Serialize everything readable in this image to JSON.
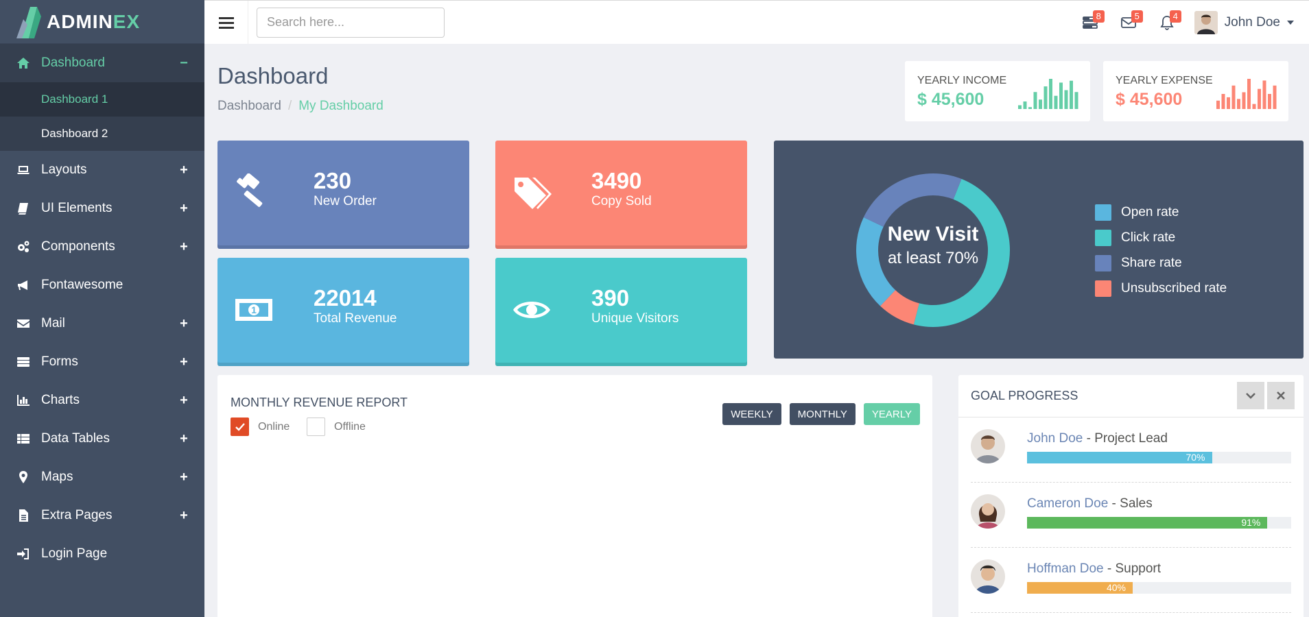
{
  "brand": {
    "name_main": "ADMIN",
    "name_accent": "EX"
  },
  "sidebar": {
    "items": [
      {
        "label": "Dashboard",
        "icon": "home-icon",
        "toggle": "−"
      },
      {
        "label": "Layouts",
        "icon": "laptop-icon",
        "toggle": "+"
      },
      {
        "label": "UI Elements",
        "icon": "book-icon",
        "toggle": "+"
      },
      {
        "label": "Components",
        "icon": "cogs-icon",
        "toggle": "+"
      },
      {
        "label": "Fontawesome",
        "icon": "bullhorn-icon",
        "toggle": ""
      },
      {
        "label": "Mail",
        "icon": "envelope-icon",
        "toggle": "+"
      },
      {
        "label": "Forms",
        "icon": "tasks-icon",
        "toggle": "+"
      },
      {
        "label": "Charts",
        "icon": "bar-chart-icon",
        "toggle": "+"
      },
      {
        "label": "Data Tables",
        "icon": "table-icon",
        "toggle": "+"
      },
      {
        "label": "Maps",
        "icon": "map-marker-icon",
        "toggle": "+"
      },
      {
        "label": "Extra Pages",
        "icon": "file-icon",
        "toggle": "+"
      },
      {
        "label": "Login Page",
        "icon": "sign-in-icon",
        "toggle": ""
      }
    ],
    "subitems": [
      {
        "label": "Dashboard 1"
      },
      {
        "label": "Dashboard 2"
      }
    ]
  },
  "header": {
    "search_placeholder": "Search here...",
    "badges": {
      "tasks": "8",
      "mail": "5",
      "notifications": "4"
    },
    "user_name": "John Doe"
  },
  "page": {
    "title": "Dashboard",
    "breadcrumb": [
      "Dashboard",
      "My Dashboard"
    ]
  },
  "yearly": {
    "income": {
      "label": "YEARLY INCOME",
      "value": "$ 45,600",
      "color": "#65cea7",
      "bars": [
        2,
        4,
        1,
        9,
        5,
        12,
        16,
        7,
        14,
        10,
        15,
        9
      ]
    },
    "expense": {
      "label": "YEARLY EXPENSE",
      "value": "$ 45,600",
      "color": "#fc8675",
      "bars": [
        5,
        9,
        7,
        14,
        6,
        10,
        18,
        3,
        12,
        17,
        9,
        14
      ]
    }
  },
  "tiles": [
    {
      "value": "230",
      "label": "New Order",
      "color": "#6883bb",
      "icon": "gavel-icon"
    },
    {
      "value": "3490",
      "label": "Copy Sold",
      "color": "#fc8675",
      "icon": "tags-icon"
    },
    {
      "value": "22014",
      "label": "Total Revenue",
      "color": "#5ab6df",
      "icon": "money-icon"
    },
    {
      "value": "390",
      "label": "Unique Visitors",
      "color": "#4acacb",
      "icon": "eye-icon"
    }
  ],
  "visits": {
    "title": "New Visit",
    "subtitle": "at least 70%",
    "legend": [
      {
        "label": "Open rate",
        "color": "#5ab6df"
      },
      {
        "label": "Click rate",
        "color": "#4acacb"
      },
      {
        "label": "Share rate",
        "color": "#6883bb"
      },
      {
        "label": "Unsubscribed rate",
        "color": "#fc8675"
      }
    ],
    "segments_pct": {
      "click": 48,
      "unsubscribed": 8,
      "open": 20,
      "share": 24
    }
  },
  "revenue": {
    "title": "MONTHLY REVENUE REPORT",
    "checkboxes": [
      {
        "label": "Online",
        "checked": true
      },
      {
        "label": "Offline",
        "checked": false
      }
    ],
    "buttons": [
      "WEEKLY",
      "MONTHLY",
      "YEARLY"
    ],
    "active_button": "YEARLY"
  },
  "goal": {
    "title": "GOAL PROGRESS",
    "people": [
      {
        "name": "John Doe",
        "role": " - Project Lead",
        "progress": "70%",
        "fraction": 0.7,
        "color": "#5bc0de"
      },
      {
        "name": "Cameron Doe",
        "role": " - Sales",
        "progress": "91%",
        "fraction": 0.91,
        "color": "#5cb85c"
      },
      {
        "name": "Hoffman Doe",
        "role": " - Support",
        "progress": "40%",
        "fraction": 0.4,
        "color": "#f0ad4e"
      }
    ]
  }
}
